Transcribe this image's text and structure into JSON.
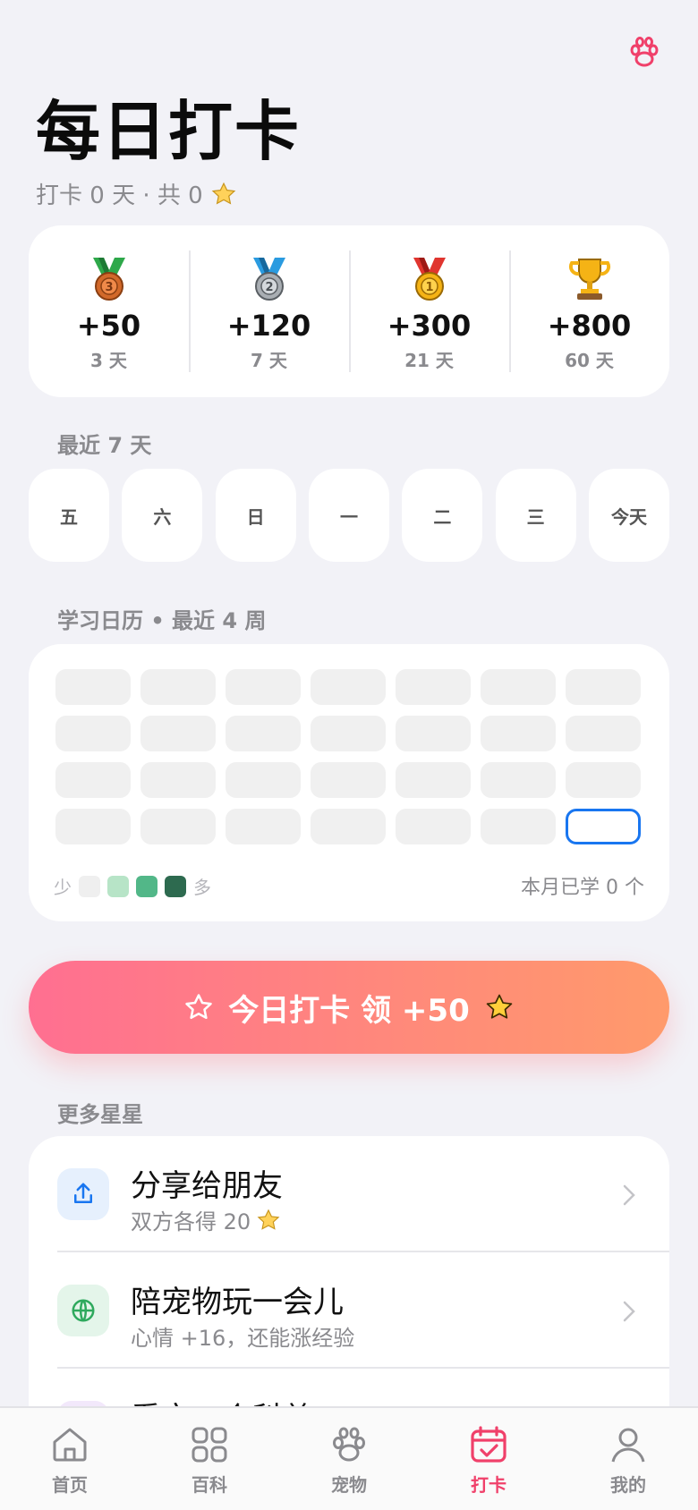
{
  "header": {
    "title": "每日打卡",
    "streak_text": "打卡 0 天 · 共 0"
  },
  "rewards": [
    {
      "points": "+50",
      "days": "3 天",
      "icon": "bronze-medal-icon"
    },
    {
      "points": "+120",
      "days": "7 天",
      "icon": "silver-medal-icon"
    },
    {
      "points": "+300",
      "days": "21 天",
      "icon": "gold-medal-icon"
    },
    {
      "points": "+800",
      "days": "60 天",
      "icon": "trophy-icon"
    }
  ],
  "recent": {
    "label": "最近 7 天",
    "days": [
      "五",
      "六",
      "日",
      "一",
      "二",
      "三",
      "今天"
    ]
  },
  "calendar": {
    "label": "学习日历 • 最近 4 周",
    "legend_less": "少",
    "legend_more": "多",
    "legend_colors": [
      "#efefef",
      "#b7e4c7",
      "#52b788",
      "#2d6a4f"
    ],
    "month_count": "本月已学 0 个",
    "today_index": 27
  },
  "cta": {
    "label": "今日打卡 领 +50"
  },
  "more": {
    "label": "更多星星",
    "items": [
      {
        "title": "分享给朋友",
        "subtitle": "双方各得 20",
        "icon": "share-icon",
        "color": "#1976f0",
        "bg": "#e6f0fd"
      },
      {
        "title": "陪宠物玩一会儿",
        "subtitle": "心情 +16，还能涨经验",
        "icon": "globe-icon",
        "color": "#2ea95d",
        "bg": "#e4f5ea"
      },
      {
        "title": "看完一个科普",
        "subtitle": "",
        "icon": "book-icon",
        "color": "#9b59d0",
        "bg": "#f2e8fb"
      }
    ]
  },
  "tabbar": {
    "items": [
      {
        "label": "首页",
        "icon": "home-icon"
      },
      {
        "label": "百科",
        "icon": "grid-icon"
      },
      {
        "label": "宠物",
        "icon": "paw-icon"
      },
      {
        "label": "打卡",
        "icon": "calendar-check-icon"
      },
      {
        "label": "我的",
        "icon": "user-icon"
      }
    ],
    "active_index": 3,
    "active_color": "#f0406a"
  }
}
